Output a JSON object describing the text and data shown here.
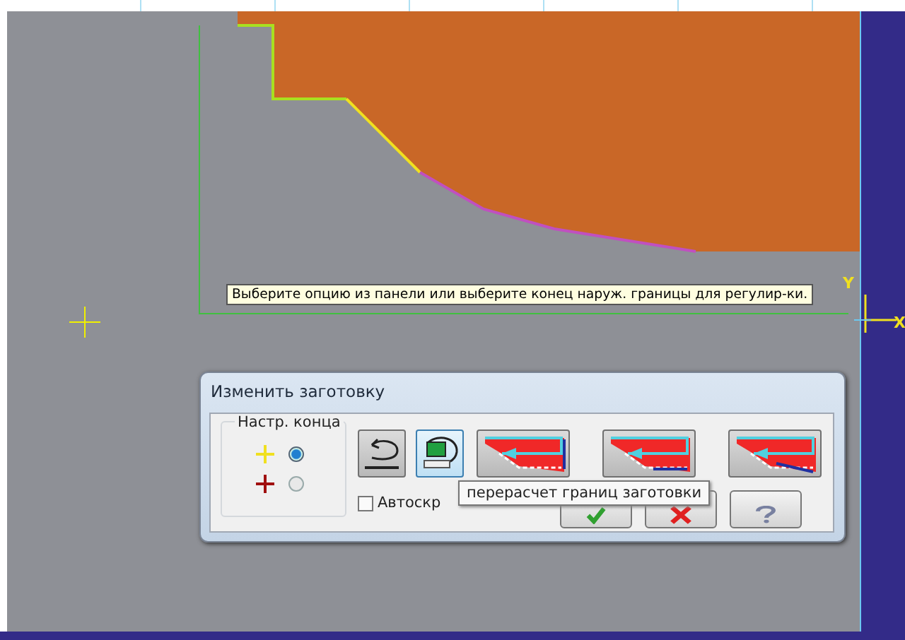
{
  "canvas": {
    "hint": "Выберите опцию из панели или выберите конец наруж. границы для регулир-ки.",
    "axis_y": "Y",
    "axis_x": "X"
  },
  "dialog": {
    "title": "Изменить заготовку",
    "group_title": "Настр. конца",
    "end_options": [
      {
        "kind": "yellow",
        "selected": true
      },
      {
        "kind": "red",
        "selected": false
      }
    ],
    "tools": [
      {
        "kind": "undo"
      },
      {
        "kind": "recalc"
      },
      {
        "kind": "edge-right"
      },
      {
        "kind": "edge-bottom"
      },
      {
        "kind": "edge-diag"
      }
    ],
    "autohide": {
      "label": "Автоскр",
      "checked": false
    },
    "actions": [
      {
        "kind": "ok"
      },
      {
        "kind": "cancel"
      },
      {
        "kind": "help"
      }
    ],
    "tooltip": "перерасчет границ заготовки"
  }
}
